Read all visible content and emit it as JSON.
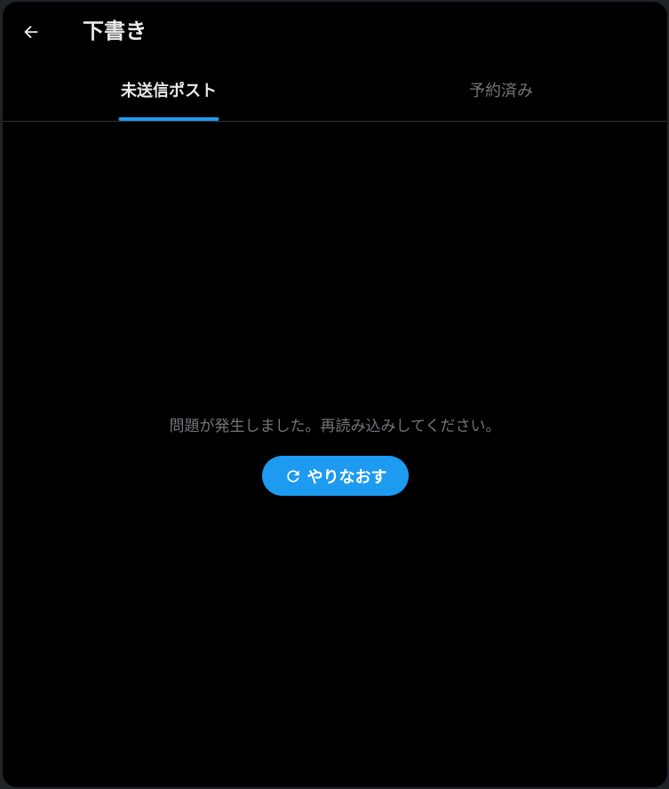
{
  "header": {
    "title": "下書き",
    "back_icon": "arrow-left-icon"
  },
  "tabs": [
    {
      "label": "未送信ポスト",
      "active": true
    },
    {
      "label": "予約済み",
      "active": false
    }
  ],
  "content": {
    "error_message": "問題が発生しました。再読み込みしてください。",
    "retry_label": "やりなおす",
    "retry_icon": "refresh-icon"
  },
  "colors": {
    "accent": "#1d9bf0",
    "background": "#000000",
    "text_primary": "#e7e9ea",
    "text_secondary": "#71767b"
  }
}
